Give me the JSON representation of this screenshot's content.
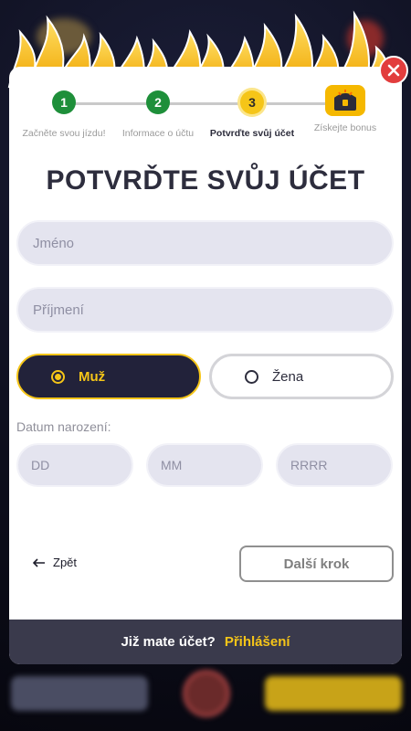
{
  "stepper": {
    "steps": [
      {
        "number": "1",
        "label": "Začněte svou jízdu!",
        "state": "done"
      },
      {
        "number": "2",
        "label": "Informace o účtu",
        "state": "done"
      },
      {
        "number": "3",
        "label": "Potvrďte svůj účet",
        "state": "active"
      },
      {
        "number": "",
        "label": "Získejte bonus",
        "state": "bonus",
        "icon": "treasure-chest-icon"
      }
    ]
  },
  "form": {
    "title": "POTVRĎTE SVŮJ ÚČET",
    "first_name_placeholder": "Jméno",
    "last_name_placeholder": "Příjmení",
    "gender": {
      "male_label": "Muž",
      "female_label": "Žena",
      "selected": "male"
    },
    "dob": {
      "label": "Datum narození:",
      "day_placeholder": "DD",
      "month_placeholder": "MM",
      "year_placeholder": "RRRR"
    },
    "back_label": "Zpět",
    "next_label": "Další krok"
  },
  "footer": {
    "question": "Již mate účet?",
    "login_link": "Přihlášení"
  },
  "colors": {
    "accent": "#f5c518",
    "done": "#1e8f3a",
    "close": "#e23d3d",
    "dark": "#22223a"
  }
}
